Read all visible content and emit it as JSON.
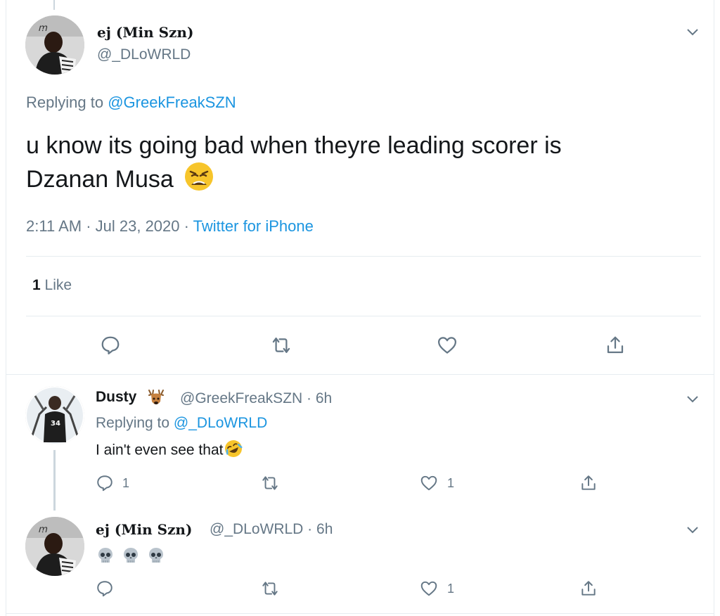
{
  "main_tweet": {
    "display_name": "ej (Min Szn)",
    "handle": "@_DLoWRLD",
    "replying_prefix": "Replying to",
    "replying_to": "@GreekFreakSZN",
    "text_line1": "u know its going bad when theyre leading scorer is",
    "text_line2": "Dzanan Musa",
    "emoji": "weary-face",
    "timestamp": "2:11 AM · Jul 23, 2020 · ",
    "source": "Twitter for iPhone",
    "like_count": "1",
    "like_label": "Like"
  },
  "replies": [
    {
      "display_name": "Dusty",
      "badge_emoji": "deer-icon",
      "handle_time": "@GreekFreakSZN · 6h",
      "replying_prefix": "Replying to",
      "replying_to": "@_DLoWRLD",
      "text": "I ain't even see that",
      "text_emoji": "rofl-face",
      "reply_count": "1",
      "retweet_count": "",
      "like_count": "1"
    },
    {
      "display_name": "ej (Min Szn)",
      "handle_time": "@_DLoWRLD · 6h",
      "text_emojis": [
        "skull-icon",
        "skull-icon",
        "skull-icon"
      ],
      "reply_count": "",
      "retweet_count": "",
      "like_count": "1"
    }
  ],
  "colors": {
    "text": "#14171a",
    "muted": "#657786",
    "link": "#1b95e0",
    "divider": "#e6ecf0"
  }
}
